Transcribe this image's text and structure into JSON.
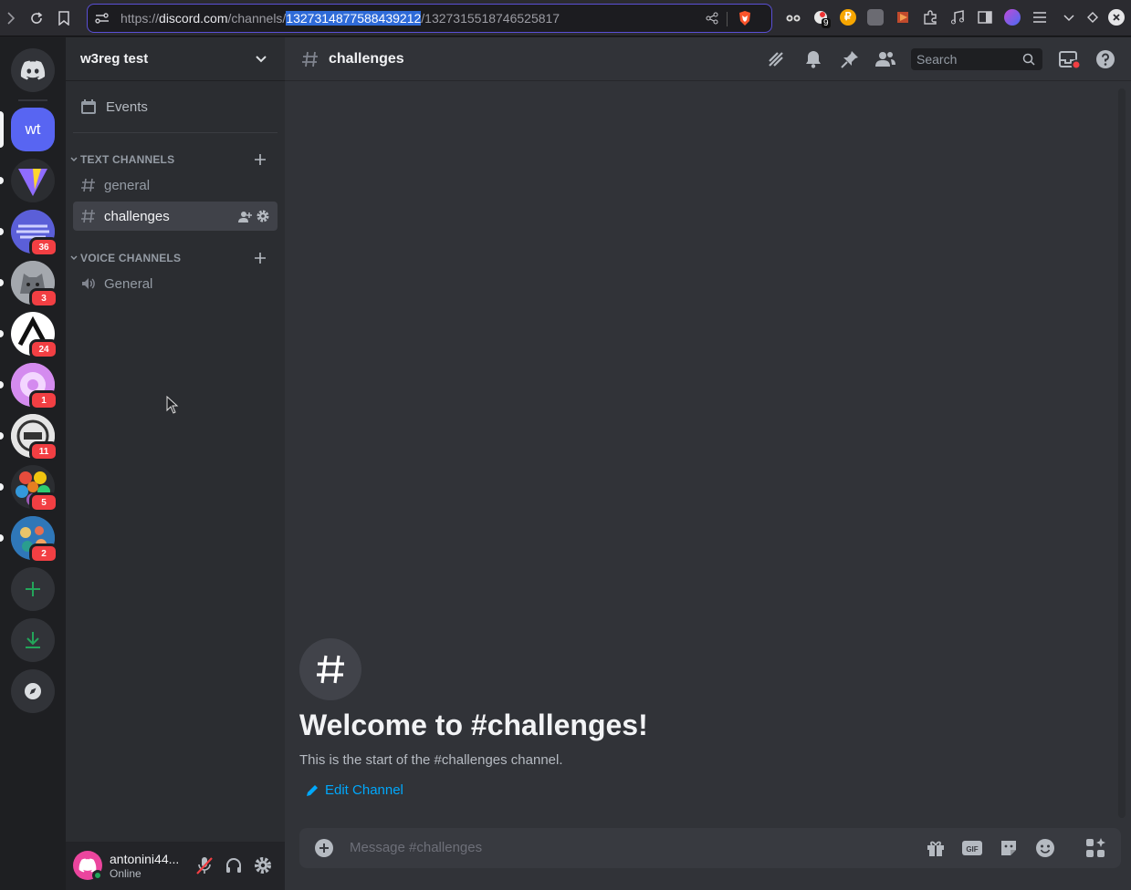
{
  "browser": {
    "url_prefix": "https://",
    "url_host": "discord.com",
    "url_path_start": "/channels/",
    "url_selected": "1327314877588439212",
    "url_rest": "/1327315518746525817",
    "extension_badge": "9"
  },
  "rail": {
    "active_server_initials": "wt",
    "servers": [
      {
        "name": "vite",
        "badge": ""
      },
      {
        "name": "stripes",
        "badge": "36"
      },
      {
        "name": "animal",
        "badge": "3"
      },
      {
        "name": "arch",
        "badge": "24"
      },
      {
        "name": "donut",
        "badge": "1"
      },
      {
        "name": "robot",
        "badge": "11"
      },
      {
        "name": "balls",
        "badge": "5"
      },
      {
        "name": "globe",
        "badge": "2"
      }
    ]
  },
  "guild": {
    "name": "w3reg test",
    "events_label": "Events",
    "text_category": "TEXT CHANNELS",
    "text_channels": [
      "general",
      "challenges"
    ],
    "voice_category": "VOICE CHANNELS",
    "voice_channels": [
      "General"
    ]
  },
  "user": {
    "name": "antonini44...",
    "status": "Online"
  },
  "channel": {
    "name": "challenges",
    "search_placeholder": "Search",
    "welcome_title": "Welcome to #challenges!",
    "welcome_text": "This is the start of the #challenges channel.",
    "edit_label": "Edit Channel",
    "composer_placeholder": "Message #challenges"
  },
  "colors": {
    "blurple": "#5865f2",
    "link": "#00a8fc",
    "green": "#23a55a",
    "red": "#f23f43"
  }
}
